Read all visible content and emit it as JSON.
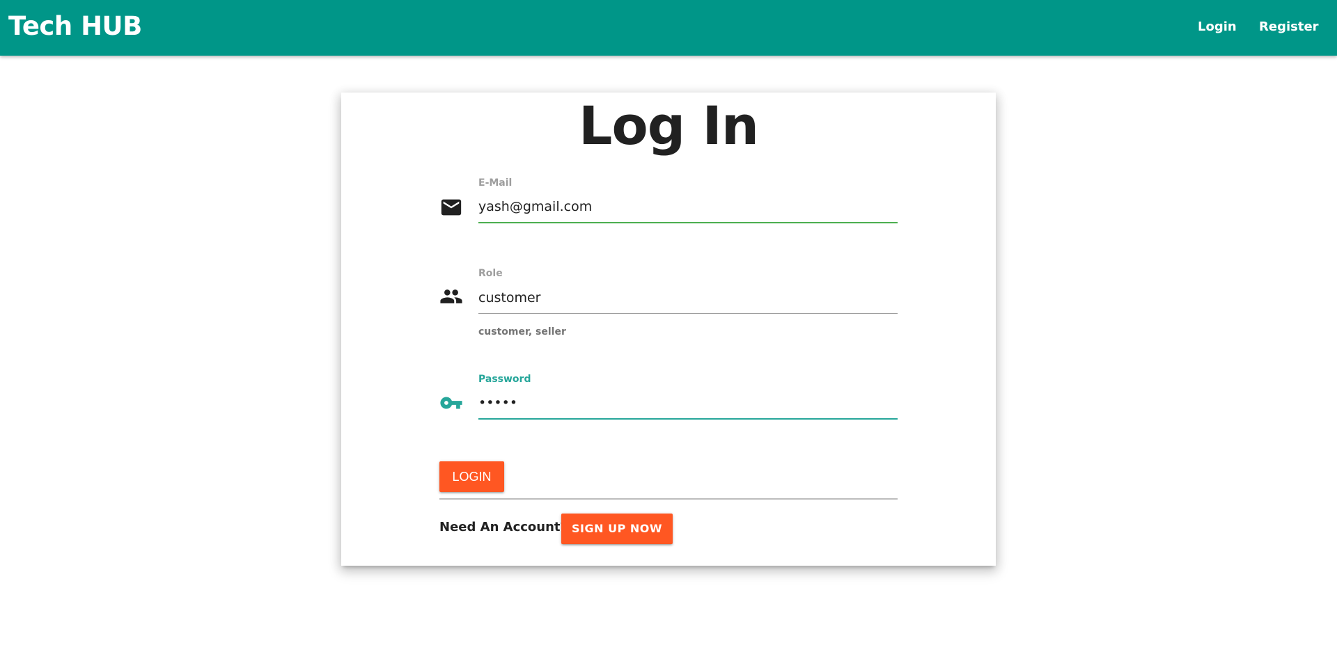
{
  "navbar": {
    "brand": "Tech HUB",
    "links": {
      "login": "Login",
      "register": "Register"
    },
    "background_color": "#009688"
  },
  "form": {
    "title": "Log In",
    "email": {
      "label": "E-Mail",
      "value": "yash@gmail.com",
      "icon": "mail-icon"
    },
    "role": {
      "label": "Role",
      "value": "customer",
      "helper": "customer, seller",
      "icon": "people-icon"
    },
    "password": {
      "label": "Password",
      "value": "•••••",
      "icon": "key-icon"
    },
    "login_button": "LOGIN",
    "need_account_text": "Need An Account?",
    "signup_button": "SIGN UP NOW"
  },
  "colors": {
    "accent": "#ff5722",
    "focus": "#26a69a",
    "valid": "#4caf50"
  }
}
